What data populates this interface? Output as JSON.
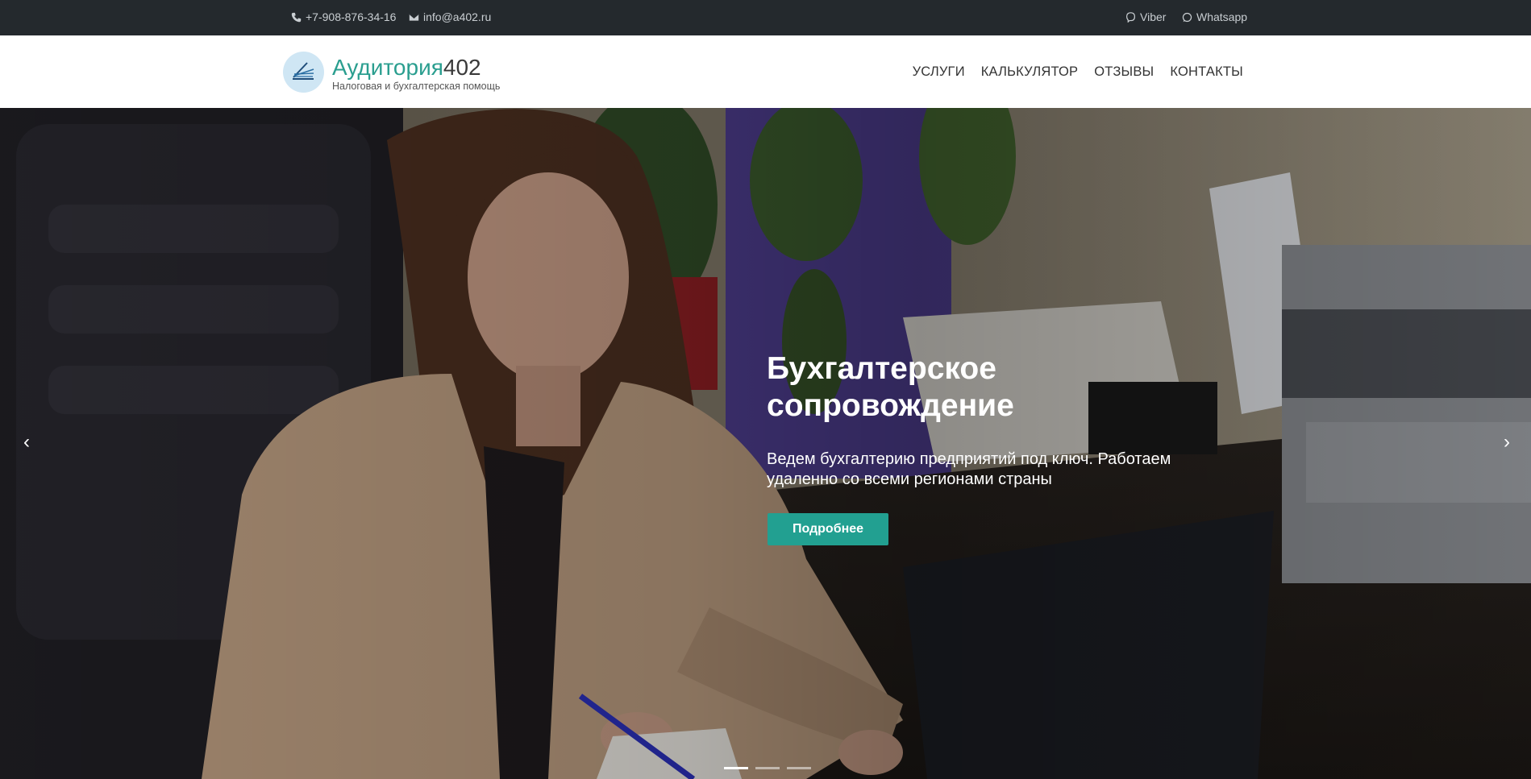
{
  "topbar": {
    "phone": "+7-908-876-34-16",
    "email": "info@a402.ru",
    "viber": "Viber",
    "whatsapp": "Whatsapp"
  },
  "header": {
    "logo_part1": "Аудитория",
    "logo_part2": "402",
    "tagline": "Налоговая и бухгалтерская помощь",
    "nav": [
      "УСЛУГИ",
      "КАЛЬКУЛЯТОР",
      "ОТЗЫВЫ",
      "КОНТАКТЫ"
    ]
  },
  "hero": {
    "title": "Бухгалтерское сопровождение",
    "text": "Ведем бухгалтерию предприятий под ключ. Работаем удаленно со всеми регионами страны",
    "button": "Подробнее",
    "prev": "‹",
    "next": "›",
    "slides_total": 3,
    "active_slide": 1
  },
  "colors": {
    "accent": "#22a091",
    "topbar_bg": "#24292d"
  }
}
